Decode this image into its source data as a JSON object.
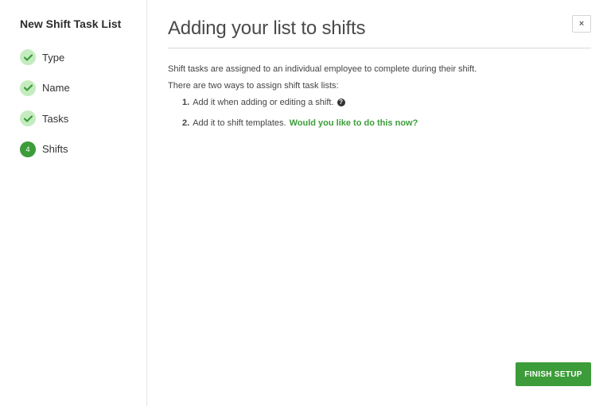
{
  "sidebar": {
    "title": "New Shift Task List",
    "steps": [
      {
        "label": "Type",
        "status": "done"
      },
      {
        "label": "Name",
        "status": "done"
      },
      {
        "label": "Tasks",
        "status": "done"
      },
      {
        "label": "Shifts",
        "status": "current",
        "number": "4"
      }
    ]
  },
  "main": {
    "title": "Adding your list to shifts",
    "close_icon": "×",
    "intro": "Shift tasks are assigned to an individual employee to complete during their shift.",
    "ways": "There are two ways to assign shift task lists:",
    "options": [
      {
        "number": "1.",
        "text": "Add it when adding or editing a shift.",
        "help_icon": "?"
      },
      {
        "number": "2.",
        "text": "Add it to shift templates.",
        "link": "Would you like to do this now?"
      }
    ],
    "finish_label": "FINISH SETUP"
  },
  "colors": {
    "accent": "#3d9c3a",
    "done_badge": "#c5ecc0"
  }
}
